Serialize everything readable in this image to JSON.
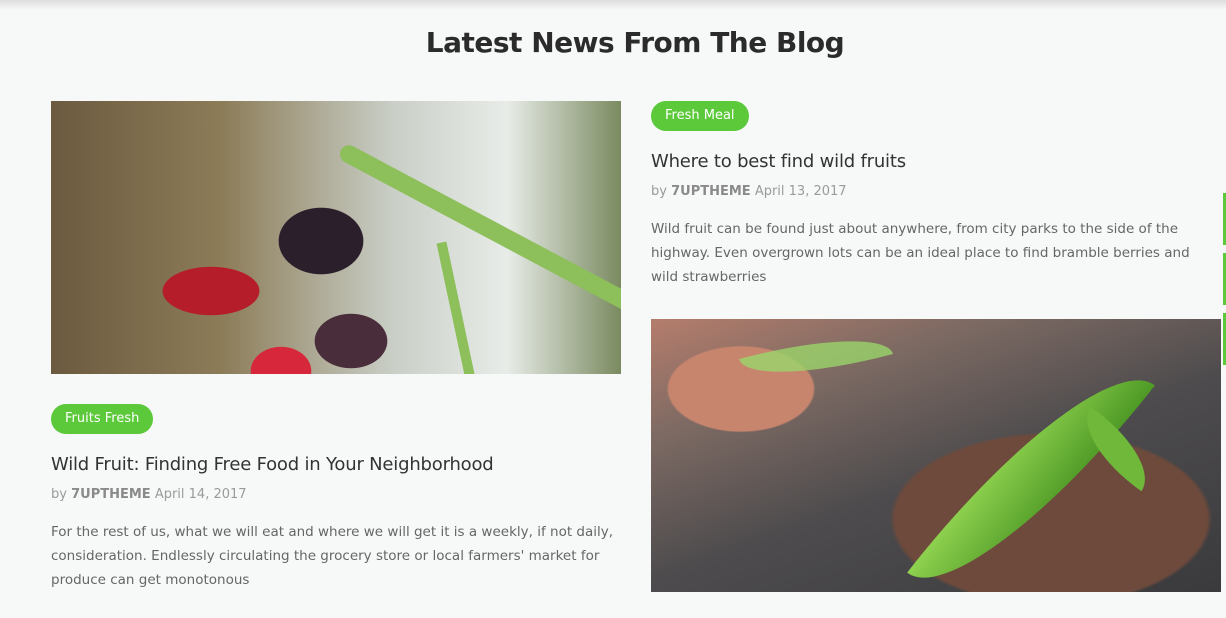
{
  "section": {
    "title": "Latest News From The Blog"
  },
  "posts": [
    {
      "tag": "Fruits Fresh",
      "title": "Wild Fruit: Finding Free Food in Your Neighborhood",
      "by": "by",
      "author": "7UPTHEME",
      "date": "April 14, 2017",
      "excerpt": "For the rest of us, what we will eat and where we will get it is a weekly, if not daily, consideration. Endlessly circulating the grocery store or local farmers' market for produce can get monotonous"
    },
    {
      "tag": "Fresh Meal",
      "title": "Where to best find wild fruits",
      "by": "by",
      "author": "7UPTHEME",
      "date": "April 13, 2017",
      "excerpt": "Wild fruit can be found just about anywhere, from city parks to the side of the highway. Even overgrown lots can be an ideal place to find bramble berries and wild strawberries"
    }
  ],
  "colors": {
    "accent": "#5cc93a",
    "background": "#f7f8f8"
  }
}
